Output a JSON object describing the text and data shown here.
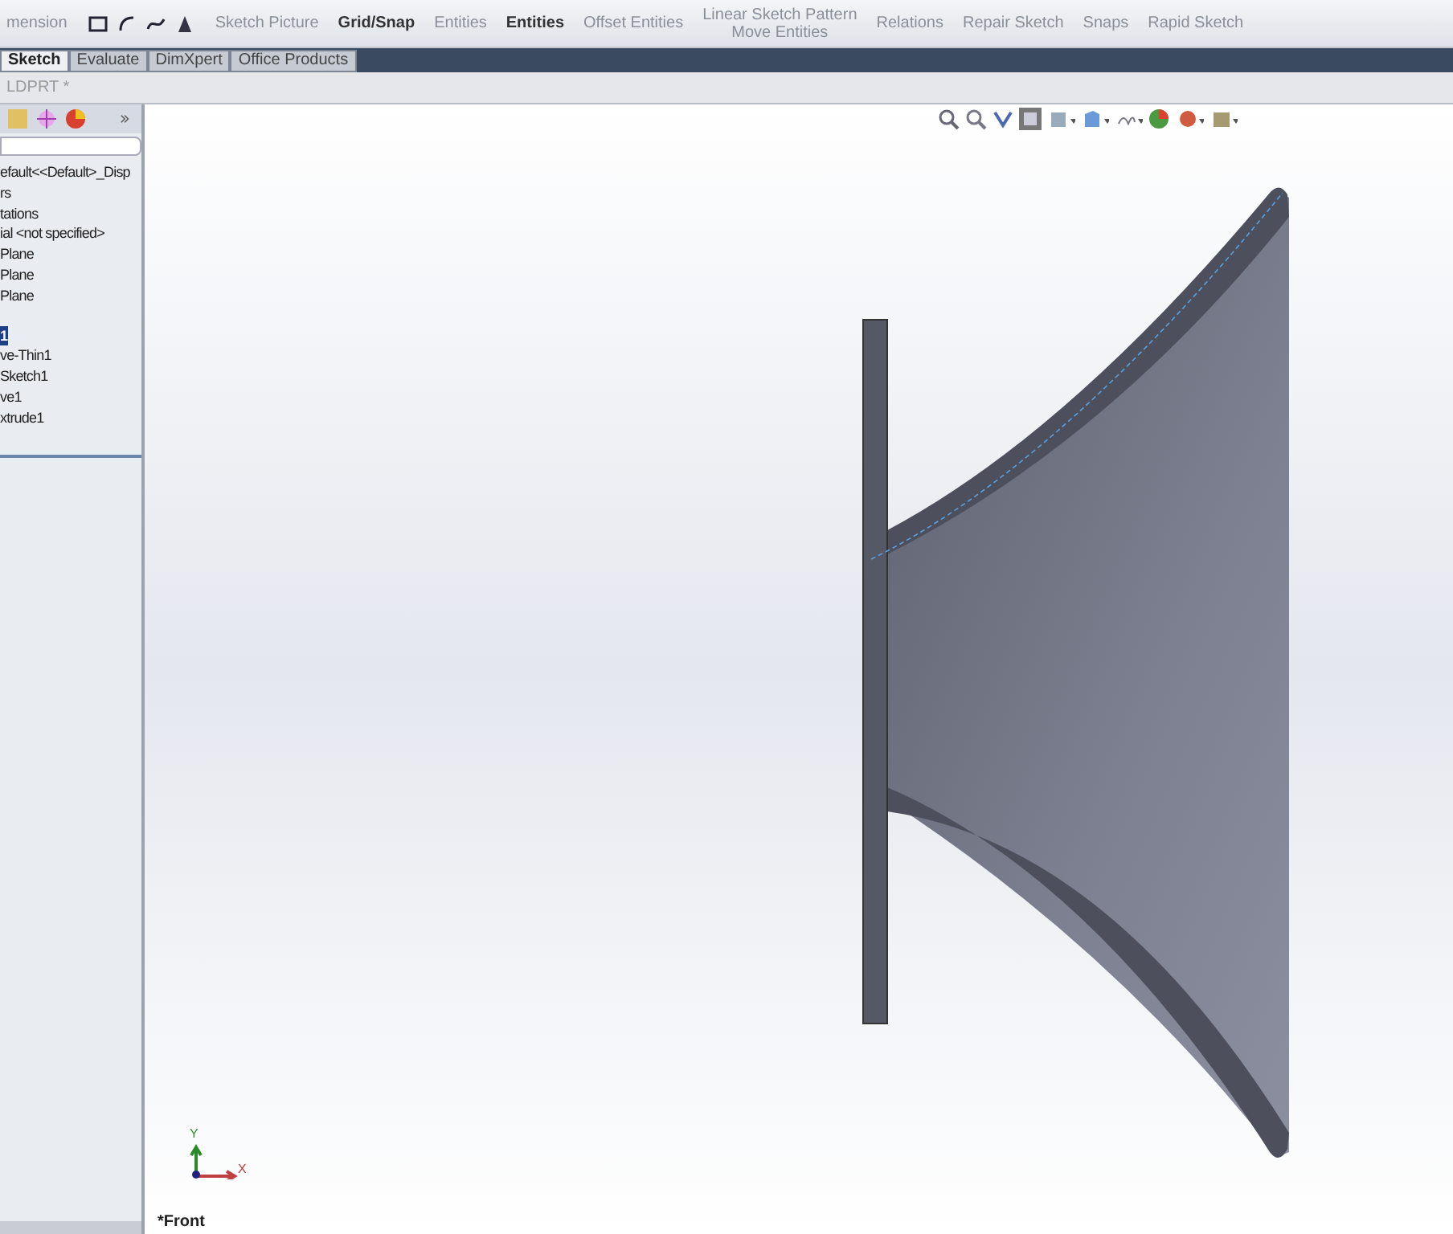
{
  "ribbon": {
    "items": [
      {
        "label": "mension"
      },
      {
        "label": "Sketch Picture"
      },
      {
        "label": "Grid/Snap"
      },
      {
        "label": "Entities"
      },
      {
        "label": "Entities"
      },
      {
        "label": "Offset Entities"
      },
      {
        "label": "Linear Sketch Pattern"
      },
      {
        "label": "Move Entities"
      },
      {
        "label": "Relations"
      },
      {
        "label": "Repair Sketch"
      },
      {
        "label": "Snaps"
      },
      {
        "label": "Rapid Sketch"
      }
    ]
  },
  "tabs": [
    {
      "label": "Sketch",
      "selected": true
    },
    {
      "label": "Evaluate",
      "selected": false
    },
    {
      "label": "DimXpert",
      "selected": false
    },
    {
      "label": "Office Products",
      "selected": false
    }
  ],
  "document": {
    "title": "LDPRT *"
  },
  "feature_tree": {
    "items": [
      {
        "label": "efault<<Default>_Disp",
        "selected": false
      },
      {
        "label": "rs",
        "selected": false
      },
      {
        "label": "tations",
        "selected": false
      },
      {
        "label": "ial <not specified>",
        "selected": false
      },
      {
        "label": "Plane",
        "selected": false
      },
      {
        "label": "Plane",
        "selected": false
      },
      {
        "label": "Plane",
        "selected": false
      },
      {
        "label": "1",
        "selected": true
      },
      {
        "label": "ve-Thin1",
        "selected": false
      },
      {
        "label": "Sketch1",
        "selected": false
      },
      {
        "label": "ve1",
        "selected": false
      },
      {
        "label": "xtrude1",
        "selected": false
      }
    ]
  },
  "viewport": {
    "view_name": "*Front",
    "triad": {
      "x": "X",
      "y": "Y"
    }
  }
}
